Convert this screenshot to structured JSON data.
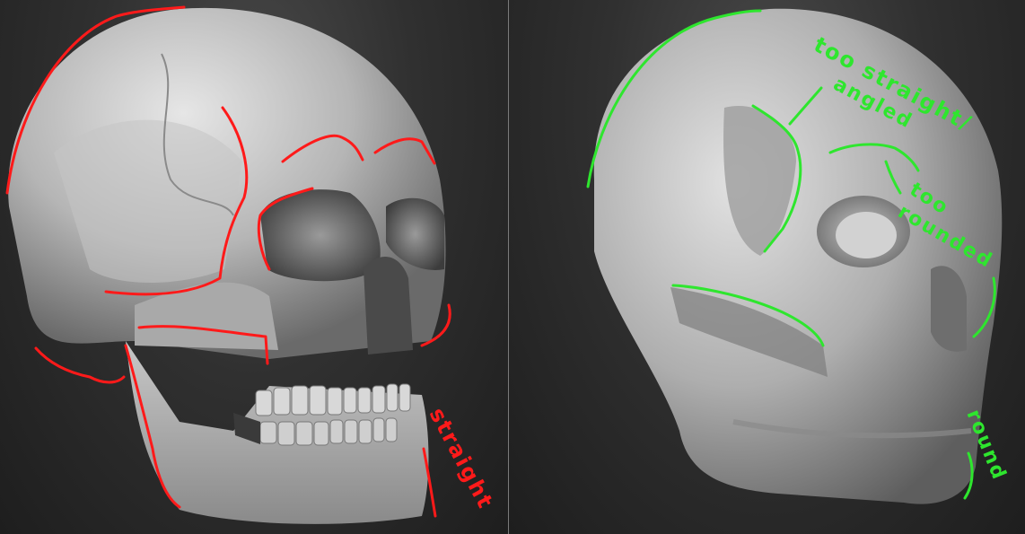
{
  "left_panel": {
    "annotations": {
      "straight": "straight"
    }
  },
  "right_panel": {
    "annotations": {
      "too_straight": "too straight/",
      "angled": "angled",
      "too": "too",
      "rounded": "rounded",
      "round": "round"
    }
  },
  "colors": {
    "left_annotation": "#ff1a1a",
    "right_annotation": "#2ee62e",
    "background": "#2b2b2b"
  }
}
